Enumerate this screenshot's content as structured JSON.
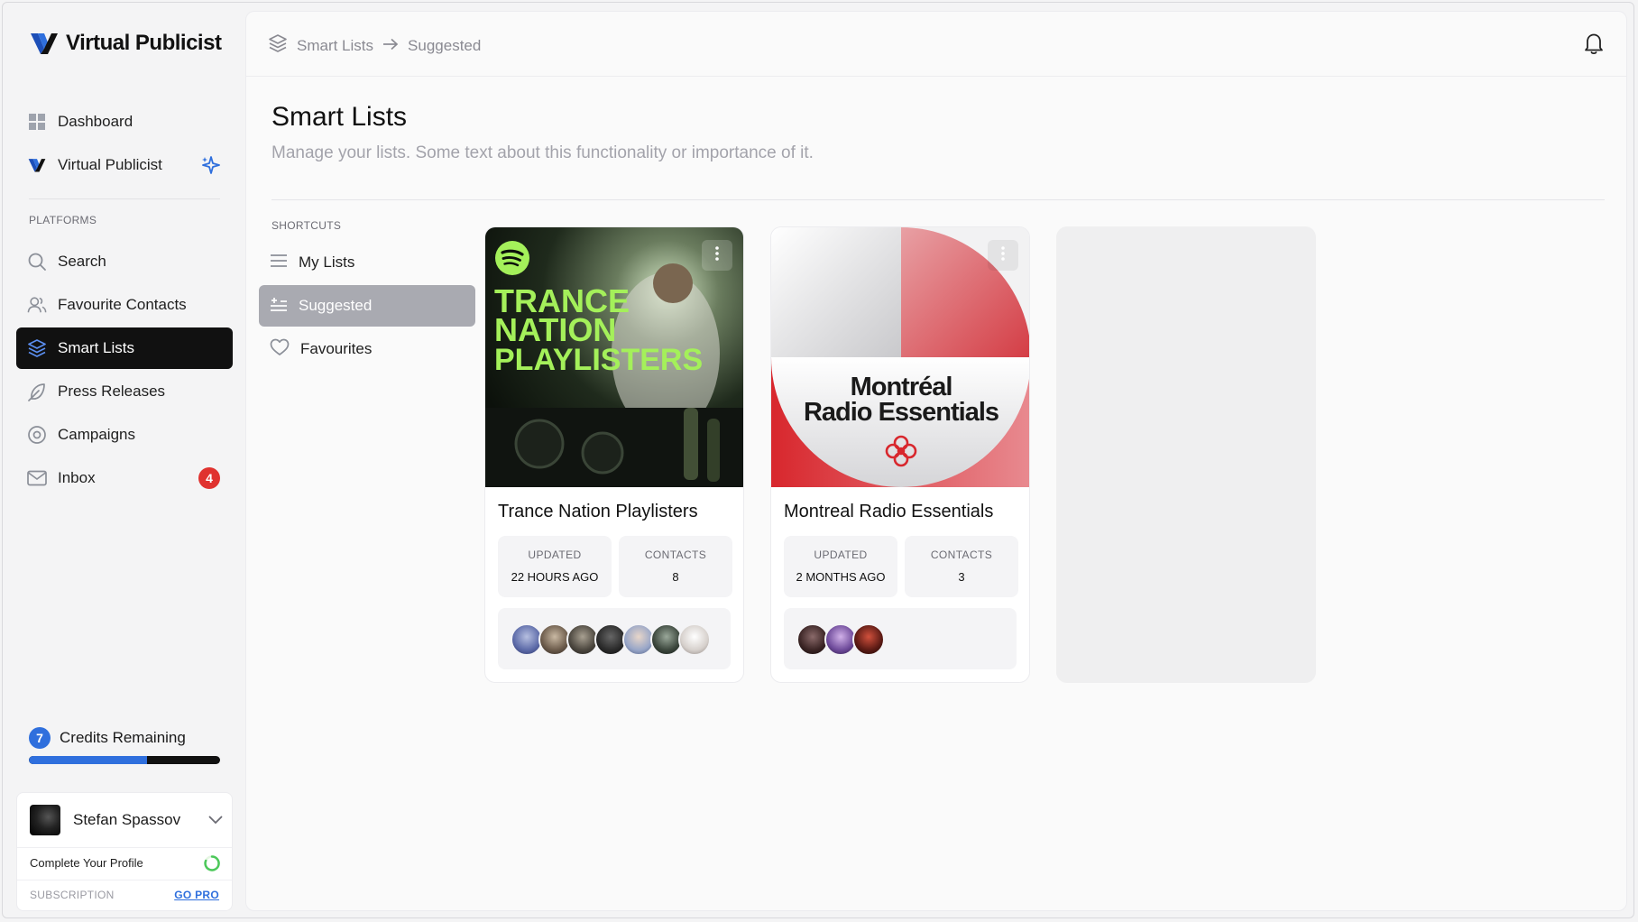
{
  "app": {
    "name": "Virtual Publicist"
  },
  "sidebar": {
    "items": [
      {
        "label": "Dashboard",
        "icon": "grid-icon"
      },
      {
        "label": "Virtual Publicist",
        "icon": "vp-logo-icon"
      }
    ],
    "platforms_label": "PLATFORMS",
    "platform_items": [
      {
        "label": "Search",
        "icon": "search-icon"
      },
      {
        "label": "Favourite Contacts",
        "icon": "users-icon"
      },
      {
        "label": "Smart Lists",
        "icon": "layers-icon",
        "active": true
      },
      {
        "label": "Press Releases",
        "icon": "feather-icon"
      },
      {
        "label": "Campaigns",
        "icon": "target-icon"
      },
      {
        "label": "Inbox",
        "icon": "mail-icon",
        "badge": "4"
      }
    ],
    "credits": {
      "count": "7",
      "label": "Credits Remaining",
      "fraction": 0.62
    },
    "profile": {
      "name": "Stefan Spassov",
      "complete_label": "Complete Your Profile",
      "subscription_label": "SUBSCRIPTION",
      "go_pro_label": "GO PRO"
    }
  },
  "header": {
    "breadcrumb": [
      "Smart Lists",
      "Suggested"
    ]
  },
  "main": {
    "title": "Smart Lists",
    "subtitle": "Manage your lists. Some text about this functionality or importance of it.",
    "shortcuts_label": "SHORTCUTS",
    "shortcuts": [
      {
        "label": "My Lists",
        "icon": "list-icon"
      },
      {
        "label": "Suggested",
        "icon": "suggested-icon",
        "active": true
      },
      {
        "label": "Favourites",
        "icon": "heart-icon"
      }
    ],
    "cards": [
      {
        "title": "Trance Nation Playlisters",
        "cover_text": [
          "TRANCE",
          "NATION",
          "PLAYLISTERS"
        ],
        "updated_label": "UPDATED",
        "updated_value": "22 HOURS AGO",
        "contacts_label": "CONTACTS",
        "contacts_value": "8"
      },
      {
        "title": "Montreal Radio Essentials",
        "cover_text": [
          "Montréal",
          "Radio Essentials"
        ],
        "updated_label": "UPDATED",
        "updated_value": "2 MONTHS AGO",
        "contacts_label": "CONTACTS",
        "contacts_value": "3"
      }
    ]
  },
  "colors": {
    "accent": "#2f6fdd",
    "active_nav": "#111111",
    "badge": "#e0322f",
    "spotify_green": "#a4f05a"
  }
}
